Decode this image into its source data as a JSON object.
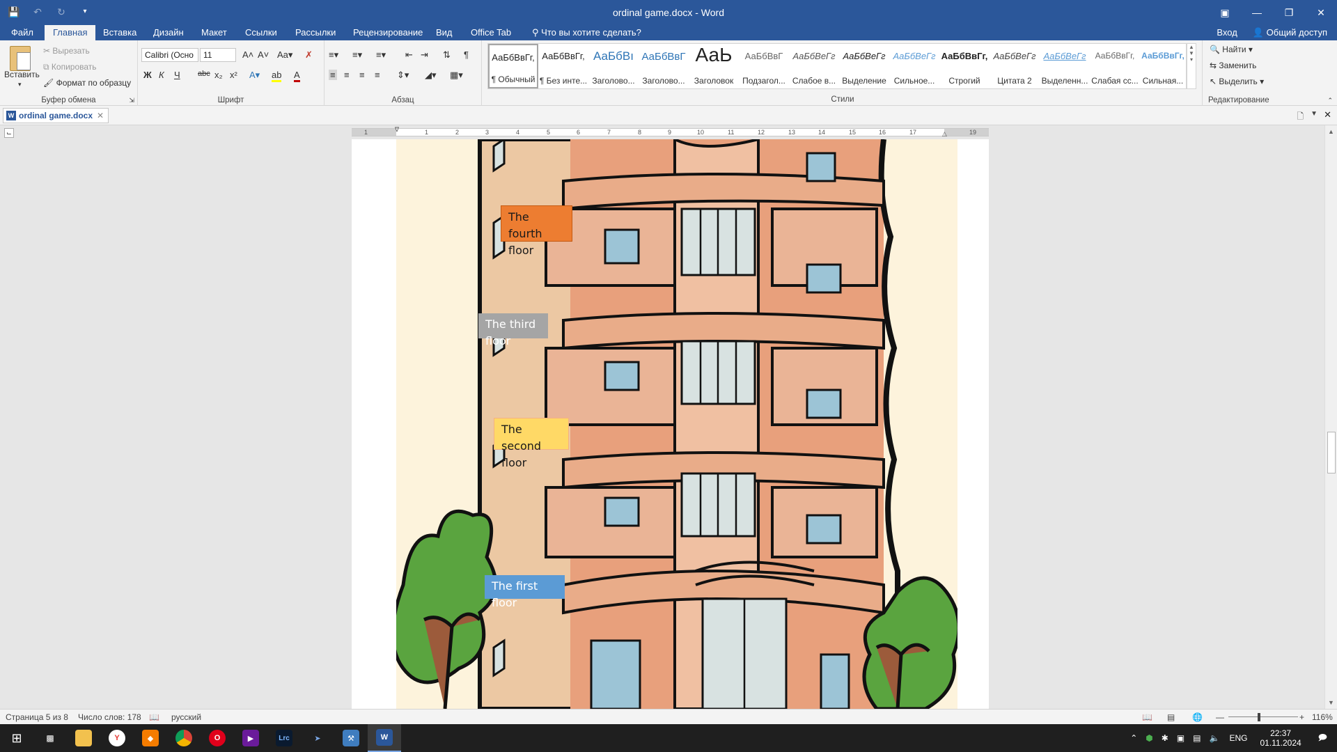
{
  "window": {
    "title": "ordinal game.docx - Word"
  },
  "tabs": {
    "items": [
      "Файл",
      "Главная",
      "Вставка",
      "Дизайн",
      "Макет",
      "Ссылки",
      "Рассылки",
      "Рецензирование",
      "Вид",
      "Office Tab"
    ],
    "tell_me": "Что вы хотите сделать?",
    "signin": "Вход",
    "share": "Общий доступ"
  },
  "ribbon": {
    "clipboard": {
      "paste": "Вставить",
      "cut": "Вырезать",
      "copy": "Копировать",
      "format_painter": "Формат по образцу",
      "label": "Буфер обмена"
    },
    "font": {
      "font_name": "Calibri (Осно",
      "font_size": "11",
      "label": "Шрифт"
    },
    "paragraph": {
      "label": "Абзац"
    },
    "styles": {
      "label": "Стили",
      "items": [
        {
          "preview": "АаБбВвГг,",
          "name": "¶ Обычный"
        },
        {
          "preview": "АаБбВвГг,",
          "name": "¶ Без инте..."
        },
        {
          "preview": "АаБбВı",
          "name": "Заголово..."
        },
        {
          "preview": "АаБбВвГ",
          "name": "Заголово..."
        },
        {
          "preview": "АаЬ",
          "name": "Заголовок"
        },
        {
          "preview": "АаБбВвГ",
          "name": "Подзагол..."
        },
        {
          "preview": "АаБбВеГг",
          "name": "Слабое в..."
        },
        {
          "preview": "АаБбВеГг",
          "name": "Выделение"
        },
        {
          "preview": "АаБбВеГг",
          "name": "Сильное..."
        },
        {
          "preview": "АаБбВвГг,",
          "name": "Строгий"
        },
        {
          "preview": "АаБбВеГг",
          "name": "Цитата 2"
        },
        {
          "preview": "АаБбВеГг",
          "name": "Выделенн..."
        },
        {
          "preview": "АаБбВвГг,",
          "name": "Слабая сс..."
        },
        {
          "preview": "АаБбВвГг,",
          "name": "Сильная..."
        }
      ]
    },
    "editing": {
      "find": "Найти",
      "replace": "Заменить",
      "select": "Выделить",
      "label": "Редактирование"
    }
  },
  "document_tab": {
    "name": "ordinal game.docx"
  },
  "ruler": {
    "ticks": [
      "1",
      "1",
      "2",
      "3",
      "4",
      "5",
      "6",
      "7",
      "8",
      "9",
      "10",
      "11",
      "12",
      "13",
      "14",
      "15",
      "16",
      "17",
      "19"
    ]
  },
  "floors": {
    "fourth": "The fourth floor",
    "third": "The third floor",
    "second": "The second floor",
    "first": "The first floor"
  },
  "statusbar": {
    "page": "Страница 5 из 8",
    "words": "Число слов: 178",
    "language": "русский",
    "zoom": "116%"
  },
  "taskbar": {
    "lang": "ENG",
    "time": "22:37",
    "date": "01.11.2024"
  },
  "colors": {
    "word_blue": "#2b579a",
    "fourth_floor": "#ed7d31",
    "third_floor": "#a5a5a5",
    "second_floor": "#ffd966",
    "first_floor": "#5b9bd5"
  }
}
